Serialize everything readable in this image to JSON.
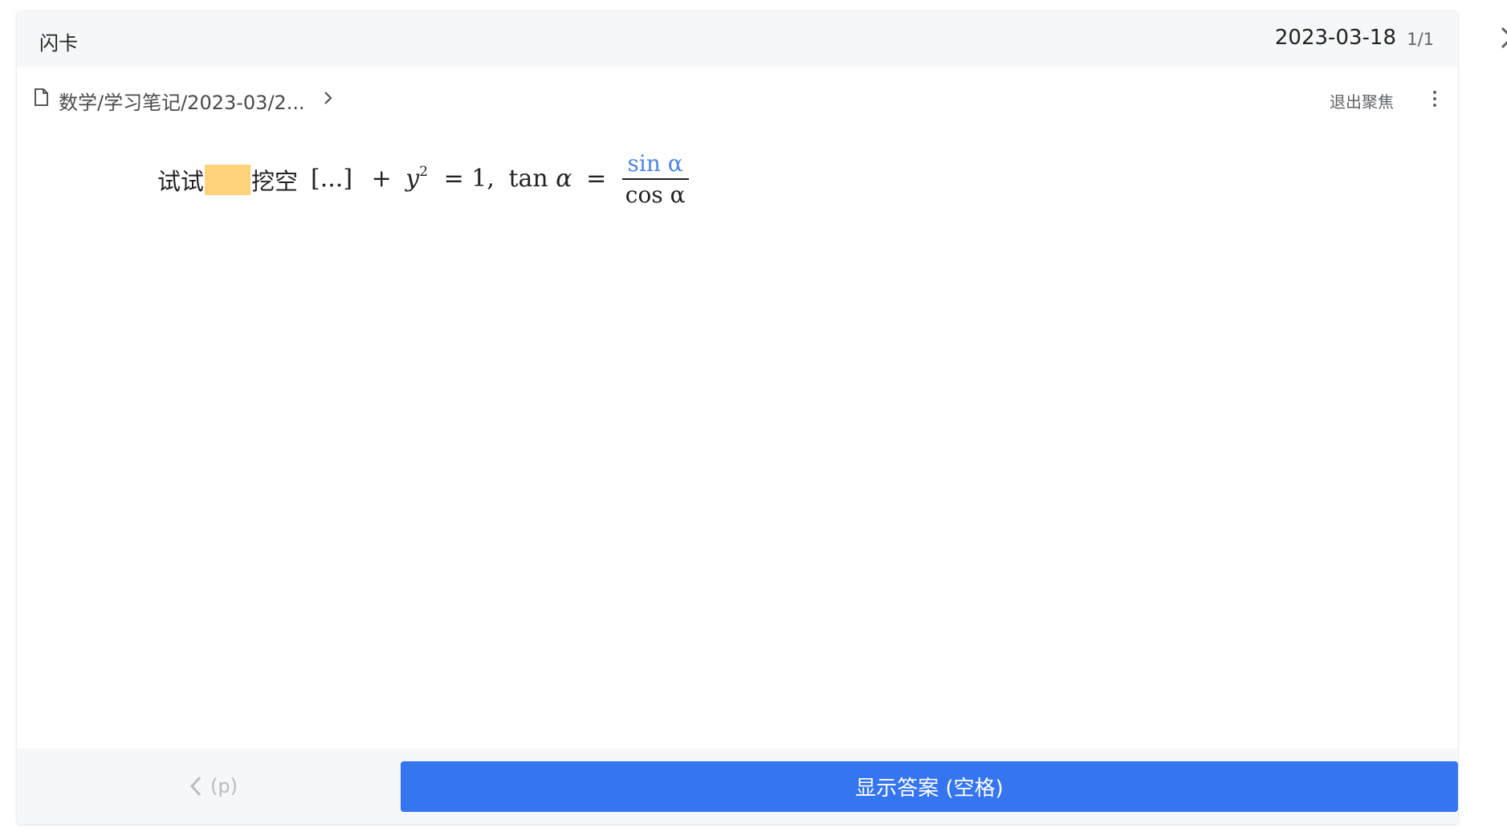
{
  "header": {
    "title": "闪卡",
    "date": "2023-03-18",
    "count": "1/1"
  },
  "breadcrumb": {
    "path": "数学/学习笔记/2023-03/2...",
    "exit_focus_label": "退出聚焦"
  },
  "card": {
    "text_before": "试试",
    "text_after": "挖空",
    "placeholder": "[...]",
    "math": {
      "plus": "+",
      "var_y": "y",
      "exponent": "2",
      "equals_one": "= 1,",
      "tan": "tan",
      "alpha": "α",
      "equals": "=",
      "numerator": "sin α",
      "denominator": "cos α"
    }
  },
  "footer": {
    "prev_label": "(p)",
    "show_answer_label": "显示答案 (空格)"
  },
  "colors": {
    "accent": "#3575f0",
    "cloze": "#fdd27a",
    "numerator": "#4f85e8"
  },
  "icons": {
    "document": "document-icon",
    "chevron": "chevron-right-icon",
    "more": "more-vertical-icon",
    "prev": "chevron-left-icon",
    "close": "close-icon"
  }
}
